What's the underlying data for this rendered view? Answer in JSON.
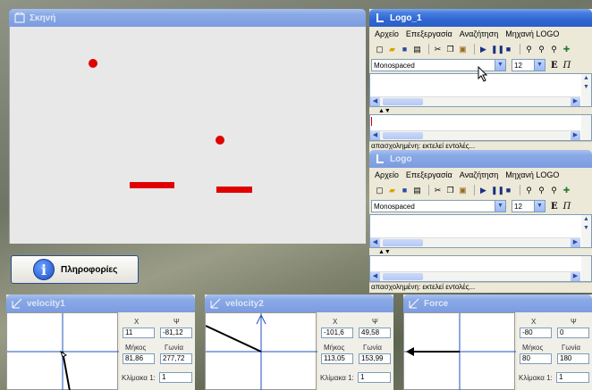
{
  "scene": {
    "title": "Σκηνή",
    "balls": [
      {
        "id": "ball-1"
      },
      {
        "id": "ball-2"
      }
    ],
    "colors": {
      "object": "#e00000",
      "background": "#e8e8e8"
    }
  },
  "info_button": {
    "label": "Πληροφορίες",
    "icon": "info-icon",
    "glyph": "i"
  },
  "logo_windows": [
    {
      "title": "Logo_1",
      "menu": [
        "Αρχείο",
        "Επεξεργασία",
        "Αναζήτηση",
        "Μηχανή LOGO"
      ],
      "font": "Monospaced",
      "font_size": "12",
      "status": "απασχολημένη: εκτελεί εντολές..."
    },
    {
      "title": "Logo",
      "menu": [
        "Αρχείο",
        "Επεξεργασία",
        "Αναζήτηση",
        "Μηχανή LOGO"
      ],
      "font": "Monospaced",
      "font_size": "12",
      "status": "απασχολημένη: εκτελεί εντολές..."
    }
  ],
  "vectors": [
    {
      "title": "velocity1",
      "x_label": "X",
      "y_label": "Ψ",
      "x": "11",
      "y": "-81,12",
      "length_label": "Μήκος",
      "angle_label": "Γωνία",
      "length": "81,86",
      "angle": "277,72",
      "scale_label": "Κλίμακα 1:",
      "scale": "1"
    },
    {
      "title": "velocity2",
      "x_label": "X",
      "y_label": "Ψ",
      "x": "-101,6",
      "y": "49,58",
      "length_label": "Μήκος",
      "angle_label": "Γωνία",
      "length": "113,05",
      "angle": "153,99",
      "scale_label": "Κλίμακα 1:",
      "scale": "1"
    },
    {
      "title": "Force",
      "x_label": "X",
      "y_label": "Ψ",
      "x": "-80",
      "y": "0",
      "length_label": "Μήκος",
      "angle_label": "Γωνία",
      "length": "80",
      "angle": "180",
      "scale_label": "Κλίμακα 1:",
      "scale": "1"
    }
  ]
}
